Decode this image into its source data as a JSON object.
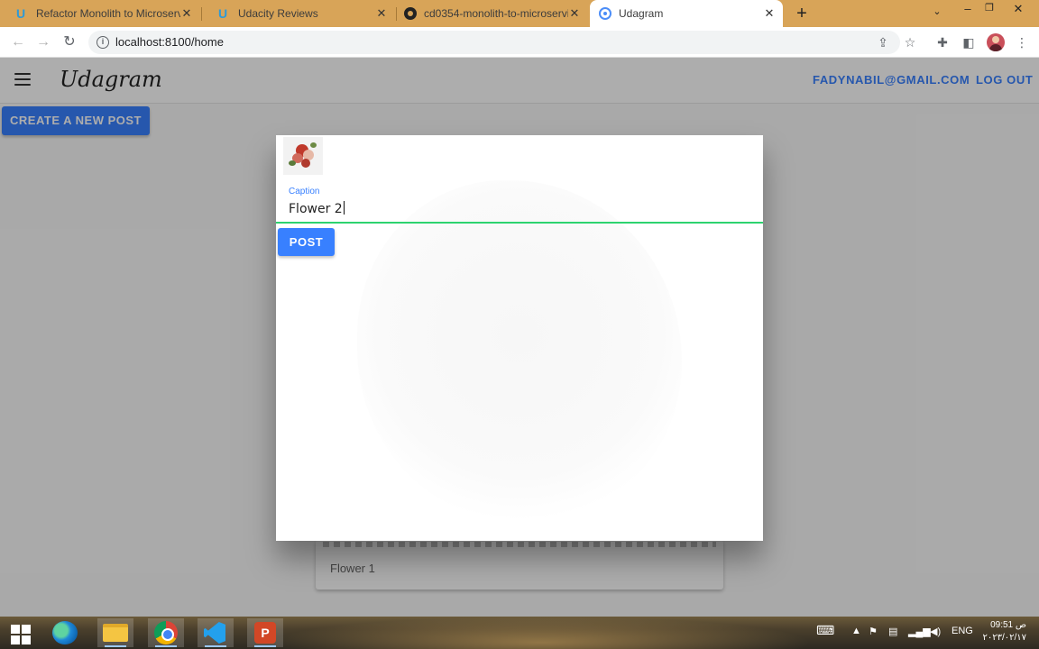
{
  "browser": {
    "tabs": [
      {
        "title": "Refactor Monolith to Microservic",
        "favicon": "udacity-icon",
        "active": false
      },
      {
        "title": "Udacity Reviews",
        "favicon": "udacity-icon",
        "active": false
      },
      {
        "title": "cd0354-monolith-to-microservic",
        "favicon": "github-icon",
        "active": false
      },
      {
        "title": "Udagram",
        "favicon": "ionic-icon",
        "active": true
      }
    ],
    "url": "localhost:8100/home"
  },
  "app": {
    "logo": "Udagram",
    "user_email": "FADYNABIL@GMAIL.COM",
    "logout_label": "LOG OUT",
    "create_post_label": "CREATE A NEW POST",
    "feed": [
      {
        "caption": "Flower 1"
      }
    ]
  },
  "modal": {
    "caption_label": "Caption",
    "caption_value": "Flower 2",
    "post_label": "POST"
  },
  "taskbar": {
    "apps": [
      "start-icon",
      "edge-icon",
      "file-explorer-icon",
      "chrome-icon",
      "vscode-icon",
      "powerpoint-icon"
    ],
    "language": "ENG",
    "time": "09:51 ص",
    "date": "٢٠٢٣/٠٢/١٧"
  },
  "colors": {
    "accent": "#3880ff",
    "input_focus": "#2dd36f",
    "tabstrip": "#d8a458"
  }
}
